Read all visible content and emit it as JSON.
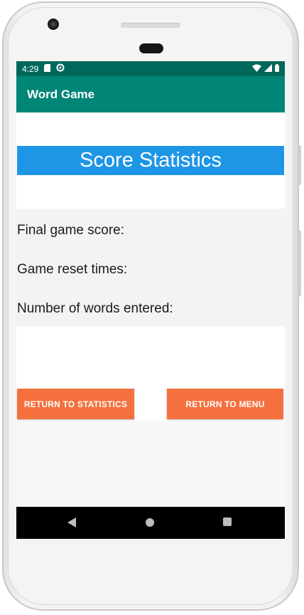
{
  "status_bar": {
    "time": "4:29",
    "left_icons": [
      "sd-card-icon",
      "sync-icon"
    ],
    "right_icons": [
      "wifi-icon",
      "cellular-signal-icon",
      "battery-icon"
    ]
  },
  "app_bar": {
    "title": "Word Game"
  },
  "screen": {
    "heading": "Score Statistics",
    "stats": [
      {
        "label": "Final game score:"
      },
      {
        "label": "Game reset times:"
      },
      {
        "label": "Number of words entered:"
      }
    ],
    "buttons": {
      "return_to_statistics": "RETURN TO STATISTICS",
      "return_to_menu": "RETURN TO MENU"
    }
  },
  "nav_bar": {
    "icons": [
      "back-icon",
      "home-icon",
      "recents-icon"
    ]
  },
  "colors": {
    "status_bar": "#00685a",
    "app_bar": "#008577",
    "heading_banner": "#1e96e6",
    "button": "#f4703d"
  }
}
